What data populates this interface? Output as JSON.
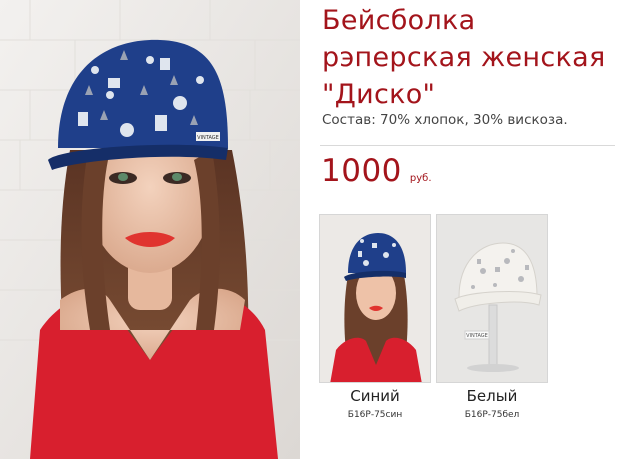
{
  "product": {
    "title": "Бейсболка рэперская женская \"Диско\"",
    "composition": "Состав: 70% хлопок, 30% вискоза.",
    "price": {
      "value": "1000",
      "currency": "руб."
    },
    "main_image_label": "VINTAGE"
  },
  "variants": [
    {
      "name": "Синий",
      "sku": "Б16Р-75син",
      "color": "#1f3f8a",
      "label": ""
    },
    {
      "name": "Белый",
      "sku": "Б16Р-75бел",
      "color": "#f4f2ee",
      "label": "VINTAGE"
    }
  ],
  "colors": {
    "accent": "#a3141b",
    "cap_blue": "#1f3f8a",
    "shirt_red": "#d81f2e"
  }
}
